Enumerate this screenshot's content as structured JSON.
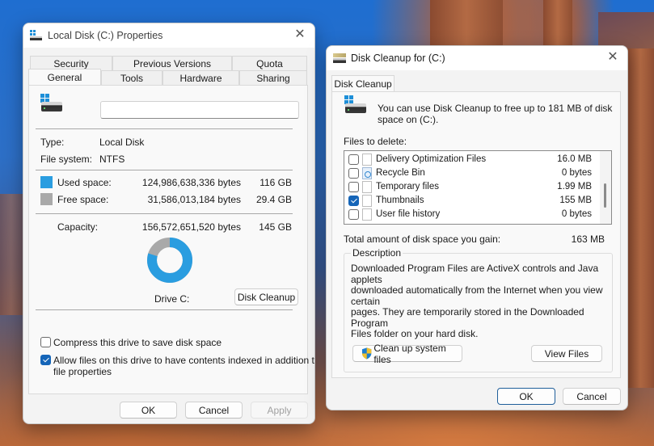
{
  "properties_window": {
    "title": "Local Disk (C:) Properties",
    "tabs_row1": [
      "Security",
      "Previous Versions",
      "Quota"
    ],
    "tabs_row2": [
      "General",
      "Tools",
      "Hardware",
      "Sharing"
    ],
    "active_tab": "General",
    "volume_label_value": "",
    "type_label": "Type:",
    "type_value": "Local Disk",
    "filesystem_label": "File system:",
    "filesystem_value": "NTFS",
    "used": {
      "label": "Used space:",
      "bytes": "124,986,638,336 bytes",
      "size": "116 GB",
      "color": "#2a9de0"
    },
    "free": {
      "label": "Free space:",
      "bytes": "31,586,013,184 bytes",
      "size": "29.4 GB",
      "color": "#a9a9a9"
    },
    "capacity": {
      "label": "Capacity:",
      "bytes": "156,572,651,520 bytes",
      "size": "145 GB"
    },
    "used_fraction": 0.798,
    "drive_label": "Drive C:",
    "disk_cleanup_button": "Disk Cleanup",
    "compress_checkbox": {
      "label": "Compress this drive to save disk space",
      "checked": false
    },
    "index_checkbox": {
      "label_line1": "Allow files on this drive to have contents indexed in addition to",
      "label_line2": "file properties",
      "checked": true
    },
    "buttons": {
      "ok": "OK",
      "cancel": "Cancel",
      "apply": "Apply"
    }
  },
  "cleanup_window": {
    "title": "Disk Cleanup for  (C:)",
    "tab": "Disk Cleanup",
    "intro_line1": "You can use Disk Cleanup to free up to 181 MB of disk",
    "intro_line2": "space on  (C:).",
    "files_to_delete_label": "Files to delete:",
    "files": [
      {
        "name": "Delivery Optimization Files",
        "size": "16.0 MB",
        "checked": false,
        "icon": "file-icon"
      },
      {
        "name": "Recycle Bin",
        "size": "0 bytes",
        "checked": false,
        "icon": "recycle-bin-icon"
      },
      {
        "name": "Temporary files",
        "size": "1.99 MB",
        "checked": false,
        "icon": "file-icon"
      },
      {
        "name": "Thumbnails",
        "size": "155 MB",
        "checked": true,
        "icon": "file-icon"
      },
      {
        "name": "User file history",
        "size": "0 bytes",
        "checked": false,
        "icon": "file-icon"
      }
    ],
    "total_label": "Total amount of disk space you gain:",
    "total_value": "163 MB",
    "description_legend": "Description",
    "description_lines": [
      "Downloaded Program Files are ActiveX controls and Java applets",
      "downloaded automatically from the Internet when you view certain",
      "pages. They are temporarily stored in the Downloaded Program",
      "Files folder on your hard disk."
    ],
    "clean_system_button": "Clean up system files",
    "view_files_button": "View Files",
    "buttons": {
      "ok": "OK",
      "cancel": "Cancel"
    }
  }
}
